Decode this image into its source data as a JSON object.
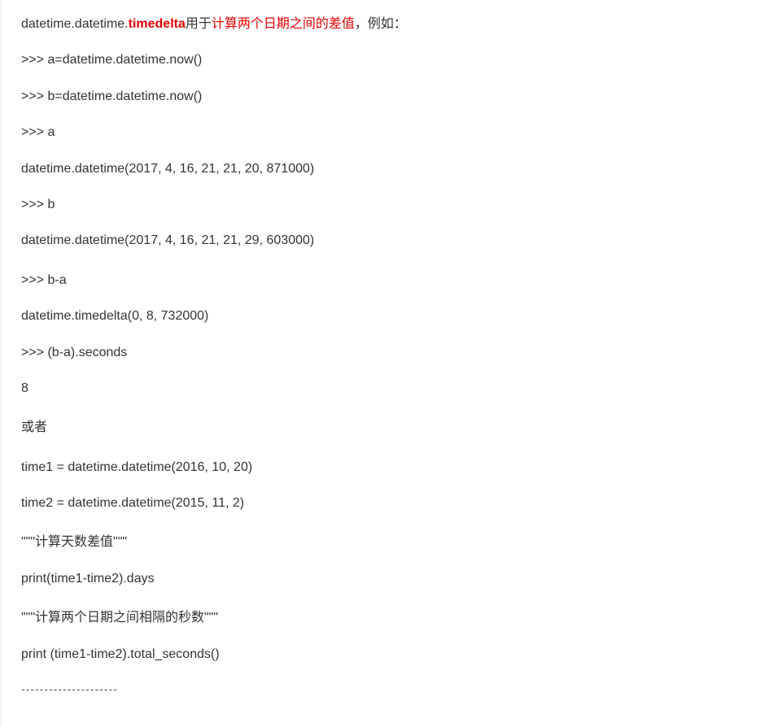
{
  "intro": {
    "prefix": "datetime.datetime.",
    "keyword": "timedelta",
    "mid": "用于",
    "highlight": "计算两个日期之间的差值",
    "suffix": "，例如："
  },
  "lines": {
    "l1": ">>> a=datetime.datetime.now()",
    "l2": ">>> b=datetime.datetime.now()",
    "l3": ">>> a",
    "l4": "datetime.datetime(2017, 4, 16, 21, 21, 20, 871000)",
    "l5": ">>> b",
    "l6": "datetime.datetime(2017, 4, 16, 21, 21, 29, 603000)",
    "l7": ">>> b-a",
    "l8": "datetime.timedelta(0, 8, 732000)",
    "l9": ">>> (b-a).seconds",
    "l10": "8",
    "l11": "或者",
    "l12": "time1 = datetime.datetime(2016, 10, 20)",
    "l13": "time2 = datetime.datetime(2015, 11, 2)",
    "l14": "\"\"\"计算天数差值\"\"\"",
    "l15": "print(time1-time2).days",
    "l16": "\"\"\"计算两个日期之间相隔的秒数\"\"\"",
    "l17": "print (time1-time2).total_seconds()",
    "l18": "---------------------"
  }
}
